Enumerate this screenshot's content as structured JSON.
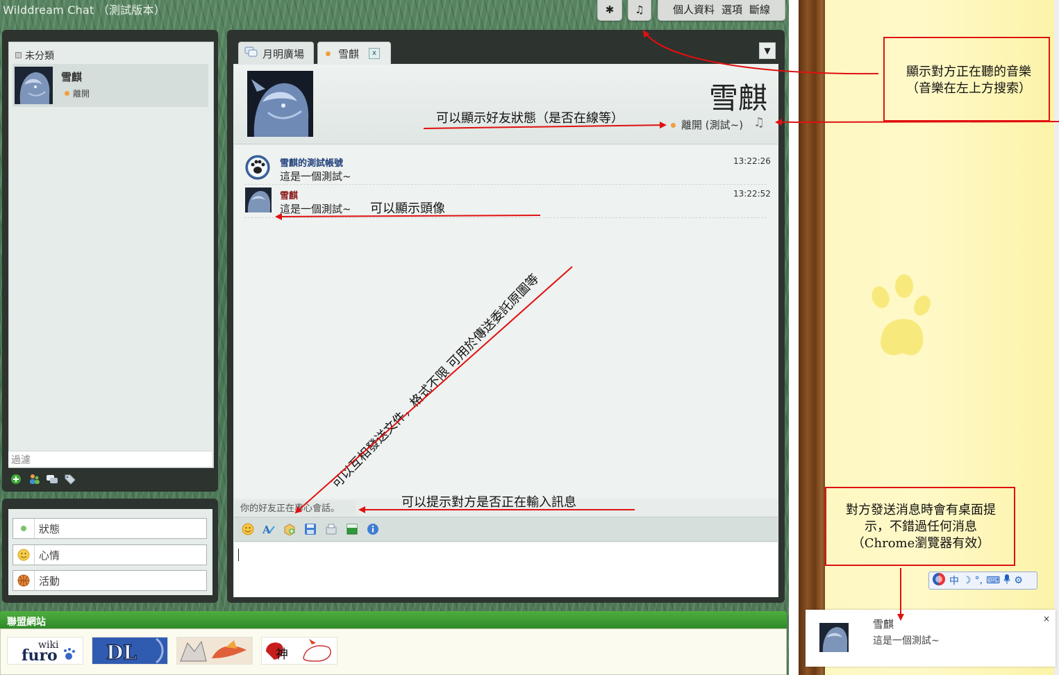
{
  "app": {
    "title": "Wilddream Chat （測試版本）",
    "top_buttons": {
      "star": "✱",
      "music": "♫"
    },
    "menu": [
      "個人資料",
      "選項",
      "斷線"
    ]
  },
  "sidebar": {
    "group_label": "未分類",
    "contact": {
      "name": "雪麒",
      "status": "離開"
    },
    "filter_placeholder": "過濾",
    "status_rows": [
      {
        "label": "狀態"
      },
      {
        "label": "心情"
      },
      {
        "label": "活動"
      }
    ]
  },
  "chat": {
    "tabs": [
      {
        "label": "月明廣場"
      },
      {
        "label": "雪麒",
        "close": "x"
      }
    ],
    "dropdown": "▼",
    "profile": {
      "name": "雪麒",
      "status": "離開 (測試~)"
    },
    "messages": [
      {
        "name": "雪麒的測試帳號",
        "text": "這是一個測試~",
        "time": "13:22:26",
        "name_color": "#1f3f7a"
      },
      {
        "name": "雪麒",
        "text": "這是一個測試~",
        "time": "13:22:52",
        "name_color": "#8a1a1a"
      }
    ],
    "typing_hint": "你的好友正在專心會話。"
  },
  "links": {
    "title": "聯盟網站",
    "logos": [
      "wikifur",
      "DL",
      "art",
      "fox"
    ],
    "wikifur_top": "wiki",
    "wikifur_bottom": "furo",
    "dl_text": "DL"
  },
  "annotations": {
    "music_note": [
      "顯示對方正在聽的音樂",
      "（音樂在左上方搜索）"
    ],
    "status_note": "可以顯示好友狀態（是否在線等）",
    "avatar_note": "可以顯示頭像",
    "file_note": "可以互相發送文件，格式不限 可用於傳送委託原圖等",
    "typing_note": "可以提示對方是否正在輸入訊息",
    "desktop_note": [
      "對方發送消息時會有桌面提",
      "示，不錯過任何消息",
      "（Chrome瀏覽器有效）"
    ]
  },
  "ime": {
    "items": [
      "中",
      "☽",
      "°,",
      "⌨",
      "🎤",
      "⚙"
    ]
  },
  "notification": {
    "name": "雪麒",
    "text": "這是一個測試~",
    "close": "×"
  },
  "colors": {
    "annotation_red": "#e01010",
    "links_green": "#3a9b31"
  }
}
